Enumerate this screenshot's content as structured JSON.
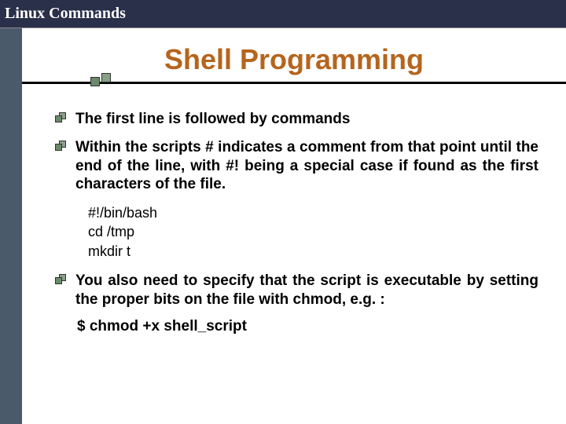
{
  "header": {
    "title": "Linux Commands"
  },
  "slide": {
    "title": "Shell Programming",
    "bullets": [
      {
        "text": "The first line is followed by commands"
      },
      {
        "text": "Within the scripts # indicates a comment from that point until the end of the line, with #! being a special case if found as the first characters of the file."
      },
      {
        "text": "You also need to specify that the script is executable by setting the proper bits on the file with chmod, e.g. :"
      }
    ],
    "code": {
      "line1": "#!/bin/bash",
      "line2": "cd /tmp",
      "line3": "mkdir t"
    },
    "command": "$ chmod +x shell_script"
  }
}
